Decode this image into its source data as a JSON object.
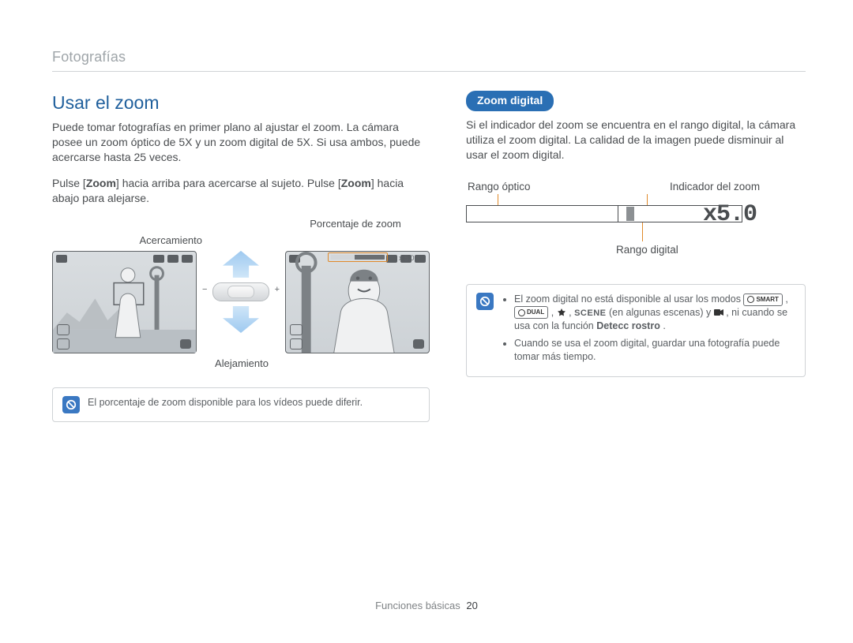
{
  "header": {
    "section": "Fotografías"
  },
  "left": {
    "title": "Usar el zoom",
    "p1": "Puede tomar fotografías en primer plano al ajustar el zoom. La cámara posee un zoom óptico de 5X y un zoom digital de 5X. Si usa ambos, puede acercarse hasta 25 veces.",
    "p2_pre": "Pulse [",
    "p2_b1": "Zoom",
    "p2_mid": "] hacia arriba para acercarse al sujeto. Pulse [",
    "p2_b2": "Zoom",
    "p2_post": "] hacia abajo para alejarse.",
    "fig": {
      "pct_label": "Porcentaje de zoom",
      "acerc": "Acercamiento",
      "alej": "Alejamiento",
      "zoom_readout": "x 5.0",
      "rocker_minus": "−",
      "rocker_plus": "+"
    },
    "note": "El porcentaje de zoom disponible para los vídeos puede diferir."
  },
  "right": {
    "pill": "Zoom digital",
    "p1": "Si el indicador del zoom se encuentra en el rango digital, la cámara utiliza el zoom digital. La calidad de la imagen puede disminuir al usar el zoom digital.",
    "range": {
      "label_optico": "Rango óptico",
      "label_indicador": "Indicador del zoom",
      "label_digital": "Rango digital",
      "value": "x5.0"
    },
    "note": {
      "li1_pre": "El zoom digital no está disponible al usar los modos ",
      "chip_smart": "SMART",
      "sep1": ", ",
      "chip_dual": "DUAL",
      "sep2": ", ",
      "scene_pre": ", ",
      "scene": "SCENE",
      "scene_paren": " (en algunas escenas) y ",
      "sep3": ", ni cuando se usa con la función ",
      "detecc": "Detecc rostro",
      "period": ".",
      "li2": "Cuando se usa el zoom digital, guardar una fotografía puede tomar más tiempo."
    }
  },
  "footer": {
    "label": "Funciones básicas",
    "page": "20"
  }
}
